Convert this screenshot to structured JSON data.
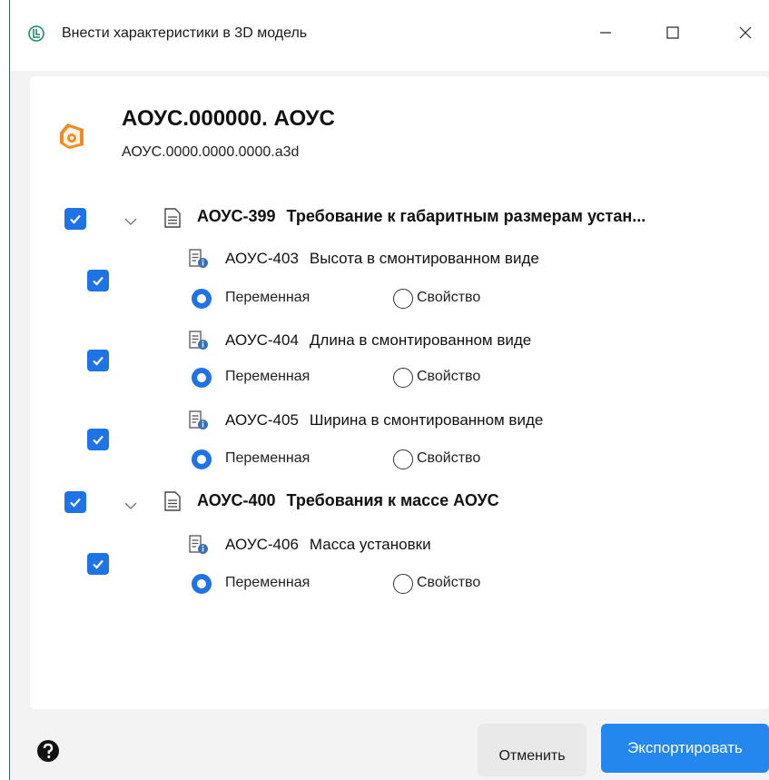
{
  "window": {
    "title": "Внести характеристики в 3D модель",
    "controls": [
      "minimize",
      "maximize",
      "close"
    ]
  },
  "model": {
    "title": "АОУС.000000.   АОУС",
    "file": "АОУС.0000.0000.0000.a3d"
  },
  "groups": [
    {
      "code": "АОУС-399",
      "label": "Требование к габаритным размерам устан...",
      "checked": true,
      "items": [
        {
          "code": "АОУС-403",
          "label": "Высота в смонтированном виде",
          "checked": true,
          "selected": "Переменная"
        },
        {
          "code": "АОУС-404",
          "label": "Длина в смонтированном виде",
          "checked": true,
          "selected": "Переменная"
        },
        {
          "code": "АОУС-405",
          "label": "Ширина в смонтированном виде",
          "checked": true,
          "selected": "Переменная"
        }
      ]
    },
    {
      "code": "АОУС-400",
      "label": "Требования к массе АОУС",
      "checked": true,
      "items": [
        {
          "code": "АОУС-406",
          "label": "Масса установки",
          "checked": true,
          "selected": "Переменная"
        }
      ]
    }
  ],
  "options": {
    "variable": "Переменная",
    "property": "Свойство"
  },
  "footer": {
    "cancel_label": "Отменить",
    "export_label": "Экспортировать"
  },
  "colors": {
    "accent": "#1e74e6",
    "export_button": "#2387ee",
    "model_icon": "#f08a24"
  },
  "icons": [
    "app-icon",
    "model-icon",
    "document-icon",
    "requirement-info-icon",
    "chevron-down-icon",
    "help-icon"
  ]
}
